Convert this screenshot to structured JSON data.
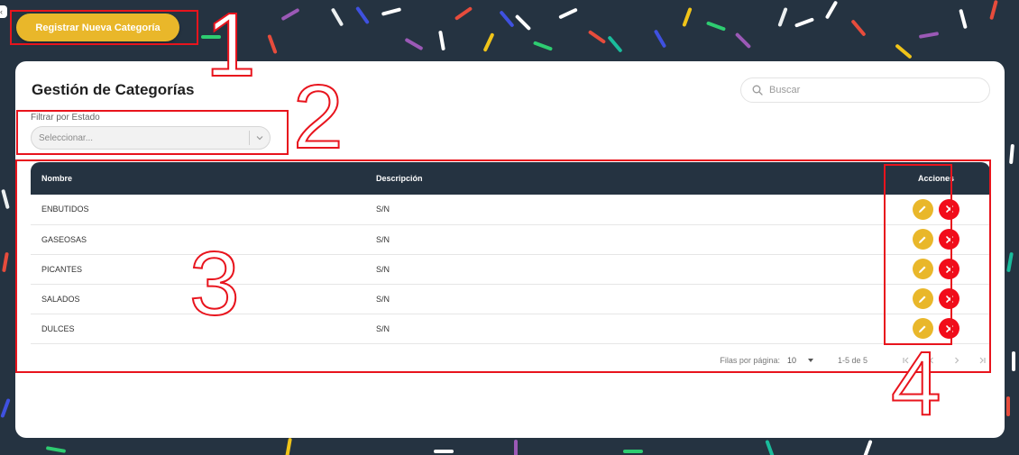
{
  "header": {
    "register_button_label": "Registrar Nueva Categoría"
  },
  "card": {
    "title": "Gestión de Categorías",
    "search": {
      "placeholder": "Buscar",
      "icon": "search-icon"
    },
    "filter": {
      "label": "Filtrar por Estado",
      "selected": "Seleccionar...",
      "icon": "chevron-down-icon"
    }
  },
  "table": {
    "columns": [
      "Nombre",
      "Descripción",
      "Acciones"
    ],
    "rows": [
      {
        "nombre": "ENBUTIDOS",
        "descripcion": "S/N"
      },
      {
        "nombre": "GASEOSAS",
        "descripcion": "S/N"
      },
      {
        "nombre": "PICANTES",
        "descripcion": "S/N"
      },
      {
        "nombre": "SALADOS",
        "descripcion": "S/N"
      },
      {
        "nombre": "DULCES",
        "descripcion": "S/N"
      }
    ],
    "action_icons": [
      "pencil-icon",
      "close-icon"
    ]
  },
  "pagination": {
    "rows_per_page_label": "Filas por página:",
    "rows_per_page_value": "10",
    "range": "1-5 de 5"
  },
  "annotations": [
    "1",
    "2",
    "3",
    "4"
  ],
  "colors": {
    "background": "#253341",
    "accent_yellow": "#e9b72a",
    "delete_red": "#f20c1a",
    "annotation_red": "#e8141d",
    "table_header": "#253341"
  }
}
